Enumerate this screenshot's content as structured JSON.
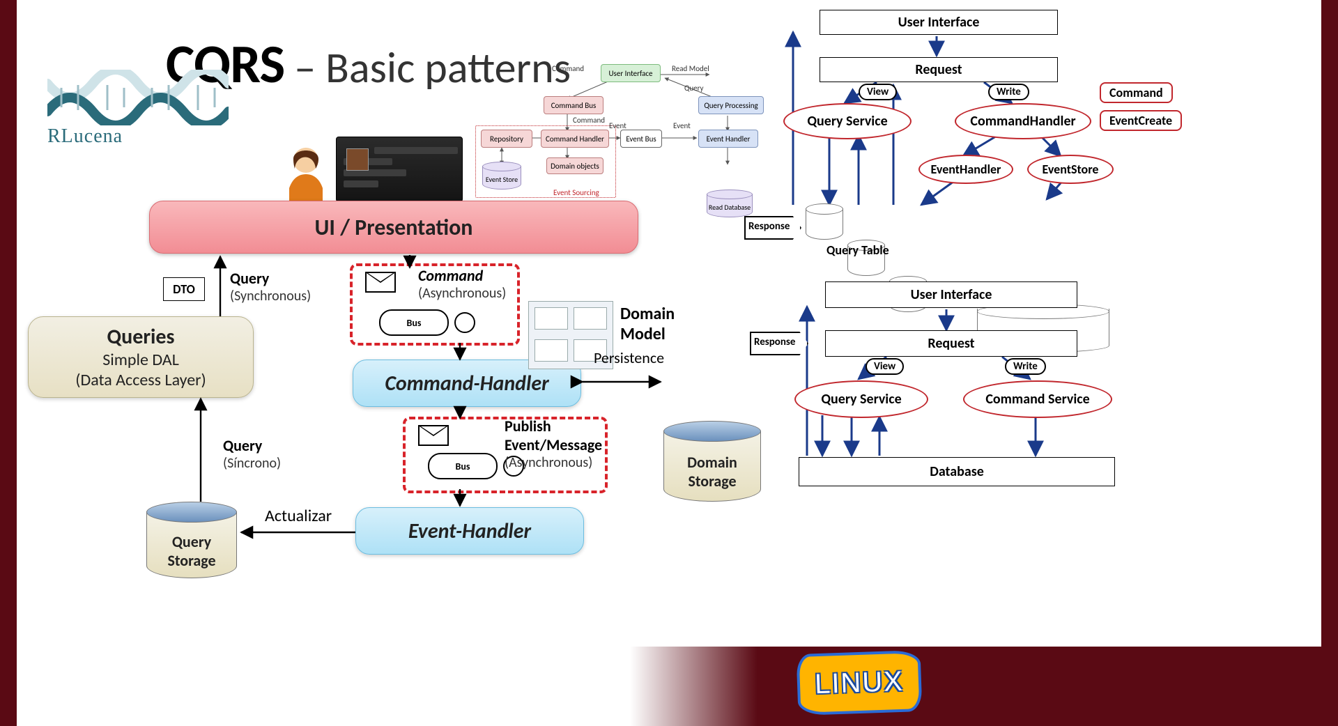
{
  "title": {
    "strong": "CQRS",
    "light": " – Basic patterns"
  },
  "logo_text": "RLucena",
  "main": {
    "ui_bar": "UI / Presentation",
    "dto": "DTO",
    "query_sync_label": "Query",
    "query_sync_sub": "(Synchronous)",
    "queries_box": {
      "h": "Queries",
      "l1": "Simple DAL",
      "l2": "(Data Access Layer)"
    },
    "query_sinc_label": "Query",
    "query_sinc_sub": "(Síncrono)",
    "query_storage": "Query\nStorage",
    "actualizar": "Actualizar",
    "command_label": "Command",
    "command_sub": "(Asynchronous)",
    "bus": "Bus",
    "command_handler": "Command-Handler",
    "publish_l1": "Publish",
    "publish_l2": "Event/Message",
    "publish_sub": "(Asynchronous)",
    "event_handler": "Event-Handler",
    "domain_model_l1": "Domain",
    "domain_model_l2": "Model",
    "persistence": "Persistence",
    "domain_storage": "Domain\nStorage"
  },
  "mini": {
    "user_interface": "User Interface",
    "command_bus": "Command Bus",
    "command": "Command",
    "repository": "Repository",
    "command_handler": "Command Handler",
    "domain_objects": "Domain objects",
    "event_store": "Event Store",
    "event_bus": "Event Bus",
    "event": "Event",
    "event_handler": "Event Handler",
    "query_processing": "Query Processing",
    "read_database": "Read Database",
    "read_model": "Read Model",
    "query": "Query",
    "event_sourcing": "Event Sourcing"
  },
  "r1": {
    "user_interface": "User Interface",
    "request": "Request",
    "view": "View",
    "write": "Write",
    "query_service": "Query Service",
    "command_handler": "CommandHandler",
    "command": "Command",
    "event_create": "EventCreate",
    "event_handler": "EventHandler",
    "event_store_oval": "EventStore",
    "event_store_cyl": "Event Store",
    "query_table": "Query Table",
    "response": "Response"
  },
  "r2": {
    "user_interface": "User Interface",
    "request": "Request",
    "view": "View",
    "write": "Write",
    "query_service": "Query Service",
    "command_service": "Command Service",
    "database": "Database",
    "response": "Response"
  },
  "linux": "LINUX"
}
